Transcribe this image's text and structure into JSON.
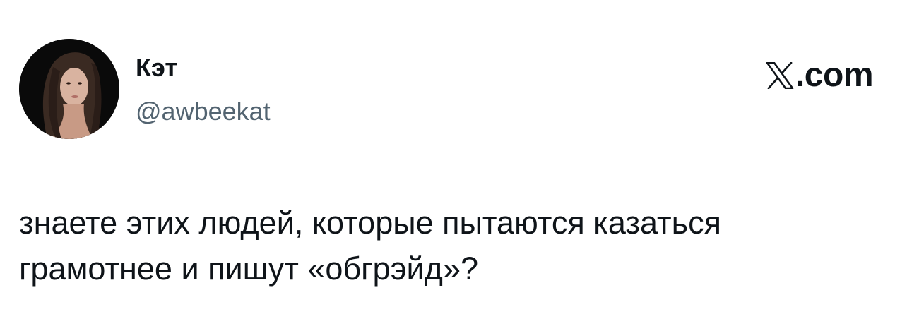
{
  "author": {
    "display_name": "Кэт",
    "handle": "@awbeekat"
  },
  "brand": {
    "icon": "x-logo-icon",
    "label": ".com"
  },
  "tweet": {
    "lines": [
      "знаете этих людей, которые пытаются казаться",
      "грамотнее и пишут «обгрэйд»?"
    ]
  },
  "colors": {
    "text": "#0f1419",
    "secondary_text": "#536471",
    "background": "#ffffff"
  }
}
